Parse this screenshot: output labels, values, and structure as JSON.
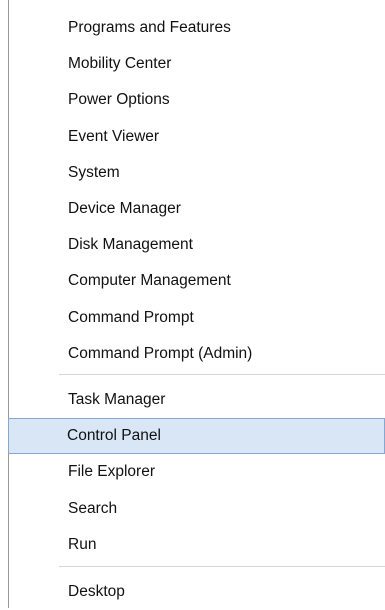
{
  "menu": {
    "group1": [
      {
        "label": "Programs and Features"
      },
      {
        "label": "Mobility Center"
      },
      {
        "label": "Power Options"
      },
      {
        "label": "Event Viewer"
      },
      {
        "label": "System"
      },
      {
        "label": "Device Manager"
      },
      {
        "label": "Disk Management"
      },
      {
        "label": "Computer Management"
      },
      {
        "label": "Command Prompt"
      },
      {
        "label": "Command Prompt (Admin)"
      }
    ],
    "group2": [
      {
        "label": "Task Manager"
      },
      {
        "label": "Control Panel",
        "selected": true
      },
      {
        "label": "File Explorer"
      },
      {
        "label": "Search"
      },
      {
        "label": "Run"
      }
    ],
    "group3": [
      {
        "label": "Desktop"
      }
    ],
    "colors": {
      "selected_background": "#d8e6f6",
      "selected_border": "#86a7d0",
      "separator": "#d6d6d6"
    }
  }
}
